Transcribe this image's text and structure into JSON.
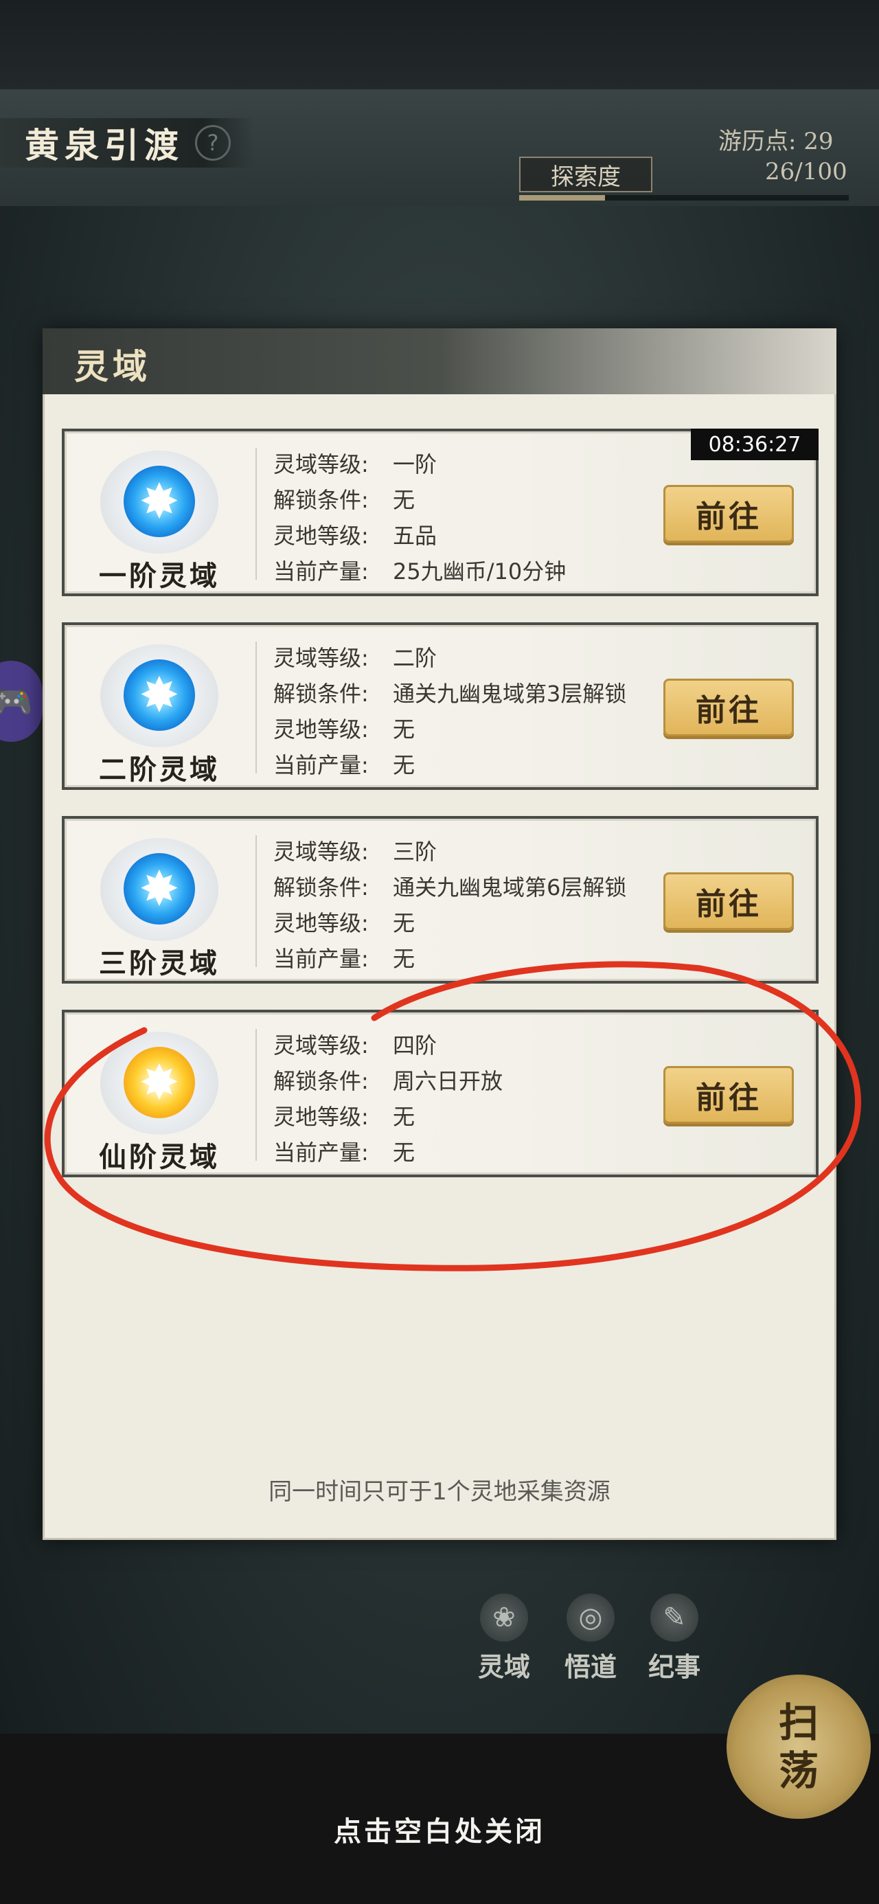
{
  "header": {
    "title": "黄泉引渡",
    "help_icon": "question-icon",
    "travel_points_label": "游历点: 29",
    "explore_label": "探索度",
    "explore_value": "26/100",
    "explore_progress": 0.26
  },
  "panel": {
    "title": "灵域",
    "footer_note": "同一时间只可于1个灵地采集资源",
    "cards": [
      {
        "name": "一阶灵域",
        "orb": "blue-orb-icon",
        "timer": "08:36:27",
        "rows": [
          {
            "label": "灵域等级:",
            "value": "一阶"
          },
          {
            "label": "解锁条件:",
            "value": "无"
          },
          {
            "label": "灵地等级:",
            "value": "五品"
          },
          {
            "label": "当前产量:",
            "value": "25九幽币/10分钟"
          }
        ],
        "button": "前往"
      },
      {
        "name": "二阶灵域",
        "orb": "blue-orb-icon",
        "rows": [
          {
            "label": "灵域等级:",
            "value": "二阶"
          },
          {
            "label": "解锁条件:",
            "value": "通关九幽鬼域第3层解锁"
          },
          {
            "label": "灵地等级:",
            "value": "无"
          },
          {
            "label": "当前产量:",
            "value": "无"
          }
        ],
        "button": "前往"
      },
      {
        "name": "三阶灵域",
        "orb": "blue-orb-icon",
        "rows": [
          {
            "label": "灵域等级:",
            "value": "三阶"
          },
          {
            "label": "解锁条件:",
            "value": "通关九幽鬼域第6层解锁"
          },
          {
            "label": "灵地等级:",
            "value": "无"
          },
          {
            "label": "当前产量:",
            "value": "无"
          }
        ],
        "button": "前往"
      },
      {
        "name": "仙阶灵域",
        "orb": "gold-orb-icon",
        "rows": [
          {
            "label": "灵域等级:",
            "value": "四阶"
          },
          {
            "label": "解锁条件:",
            "value": "周六日开放"
          },
          {
            "label": "灵地等级:",
            "value": "无"
          },
          {
            "label": "当前产量:",
            "value": "无"
          }
        ],
        "button": "前往"
      }
    ]
  },
  "bottom_nav": {
    "items": [
      {
        "label": "灵域",
        "icon": "lotus-icon"
      },
      {
        "label": "悟道",
        "icon": "swirl-icon"
      },
      {
        "label": "纪事",
        "icon": "book-icon"
      }
    ],
    "sweep_line1": "扫",
    "sweep_line2": "荡"
  },
  "close_hint": "点击空白处关闭",
  "colors": {
    "annotation_red": "#e0341f",
    "button_gold": "#e8c46e",
    "panel_bg": "#eeebe1"
  }
}
